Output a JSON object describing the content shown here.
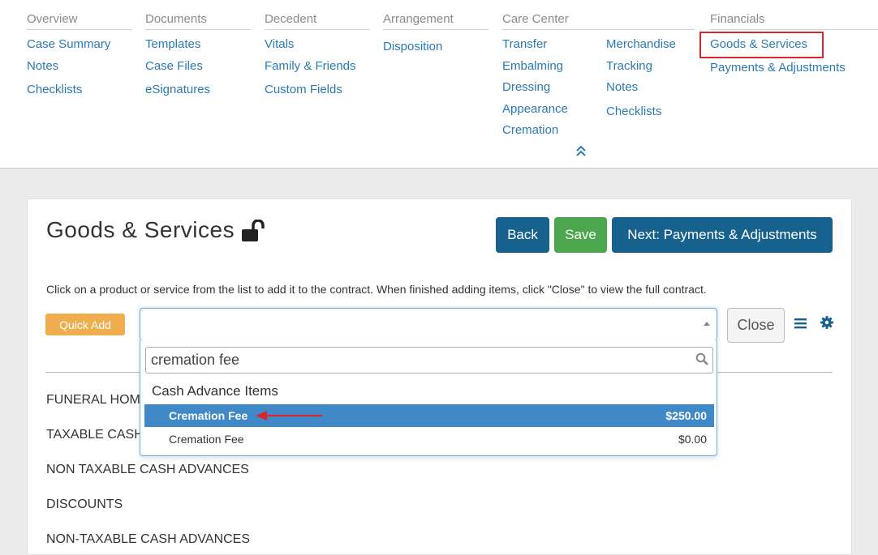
{
  "nav": {
    "columns": [
      {
        "heading": "Overview",
        "links": [
          "Case Summary",
          "Notes",
          "Checklists"
        ]
      },
      {
        "heading": "Documents",
        "links": [
          "Templates",
          "Case Files",
          "eSignatures"
        ]
      },
      {
        "heading": "Decedent",
        "links": [
          "Vitals",
          "Family & Friends",
          "Custom Fields"
        ]
      },
      {
        "heading": "Arrangement",
        "links": [
          "Disposition"
        ]
      },
      {
        "heading": "Care Center",
        "links": [
          "Transfer",
          "Embalming",
          "Dressing",
          "Appearance",
          "Cremation"
        ],
        "links2": [
          "Merchandise",
          "Tracking",
          "Notes",
          "Checklists"
        ]
      },
      {
        "heading": "Financials",
        "links": [
          "Goods & Services",
          "Payments & Adjustments"
        ],
        "active": "Goods & Services"
      }
    ]
  },
  "page": {
    "title": "Goods & Services",
    "buttons": {
      "back": "Back",
      "save": "Save",
      "next": "Next: Payments & Adjustments",
      "close": "Close",
      "quick_add": "Quick Add"
    },
    "instructions": "Click on a product or service from the list to add it to the contract. When finished adding items, click \"Close\" to view the full contract.",
    "sections": [
      "FUNERAL HOM",
      "TAXABLE CASH",
      "NON TAXABLE CASH ADVANCES",
      "DISCOUNTS",
      "NON-TAXABLE CASH ADVANCES"
    ]
  },
  "dropdown": {
    "search_value": "cremation fee",
    "group": "Cash Advance Items",
    "options": [
      {
        "name": "Cremation Fee",
        "price": "$250.00",
        "highlighted": true
      },
      {
        "name": "Cremation Fee",
        "price": "$0.00",
        "highlighted": false
      }
    ]
  },
  "colors": {
    "primary": "#17618f",
    "success": "#4ba64e",
    "warning": "#f0ad4e",
    "link": "#2a7ab7",
    "highlight": "#3f89c8",
    "annotation": "#d9262c"
  }
}
